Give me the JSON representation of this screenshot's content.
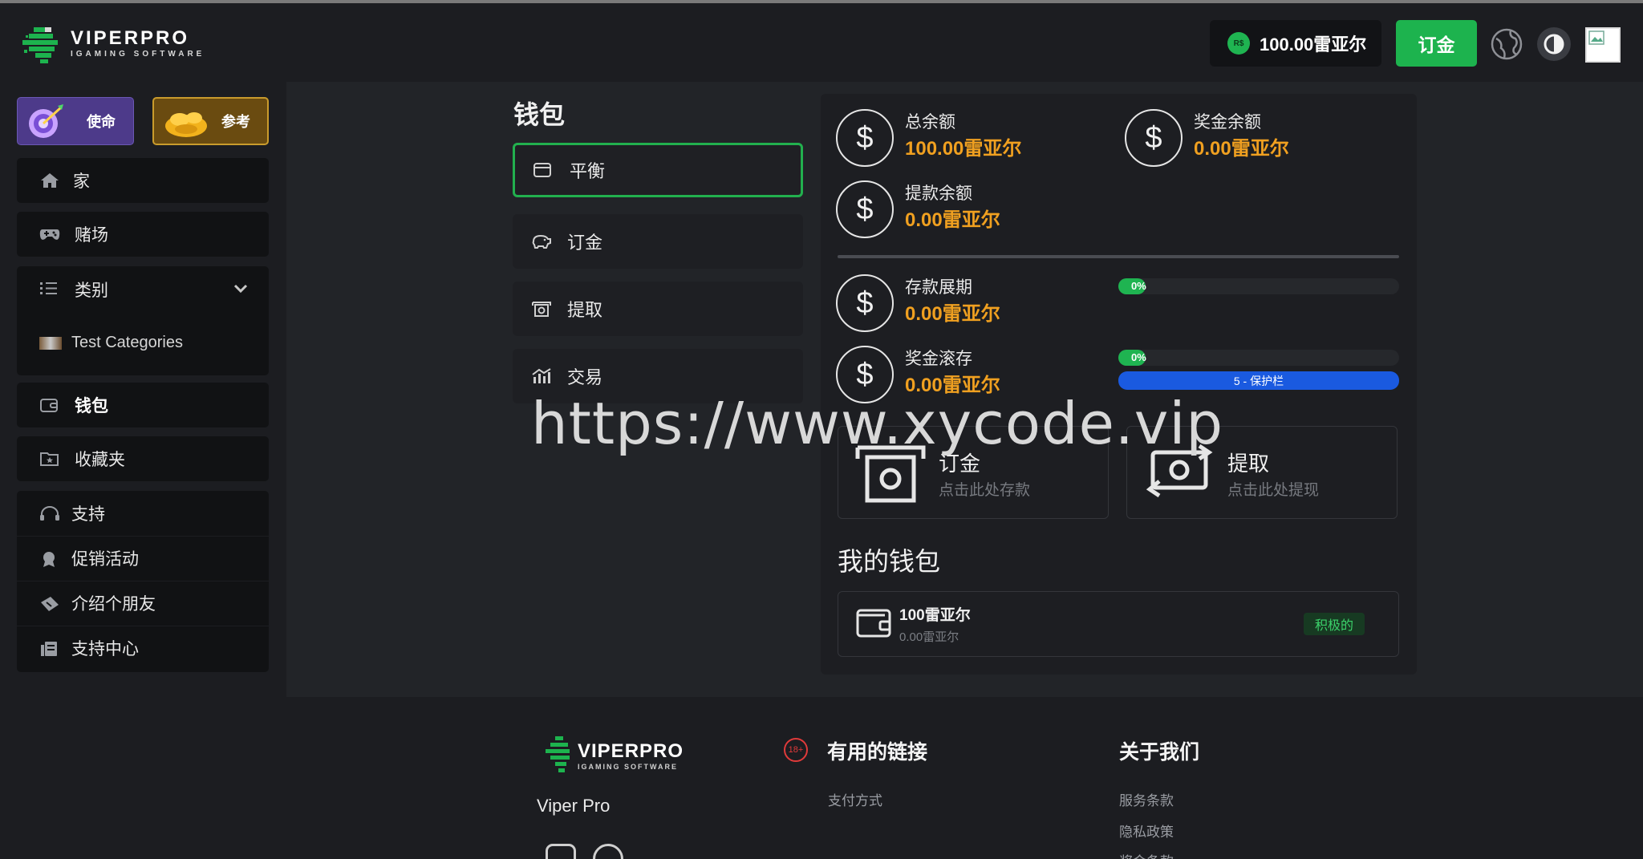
{
  "header": {
    "logo_name": "VIPERPRO",
    "logo_sub": "IGAMING SOFTWARE",
    "coin_symbol": "R$",
    "balance": "100.00雷亚尔",
    "deposit_label": "订金",
    "icons": [
      "globe-icon",
      "theme-toggle-icon",
      "avatar-image"
    ]
  },
  "sidebar": {
    "promo": [
      {
        "label": "使命",
        "icon": "target-icon"
      },
      {
        "label": "参考",
        "icon": "coins-icon"
      }
    ],
    "items": [
      {
        "label": "家",
        "icon": "home-icon"
      },
      {
        "label": "赌场",
        "icon": "gamepad-icon"
      },
      {
        "label": "类别",
        "icon": "list-icon"
      },
      {
        "label": "钱包",
        "icon": "wallet-icon"
      },
      {
        "label": "收藏夹",
        "icon": "folder-star-icon"
      }
    ],
    "category_sub": "Test Categories",
    "support": [
      {
        "label": "支持",
        "icon": "headset-icon"
      },
      {
        "label": "促销活动",
        "icon": "award-icon"
      },
      {
        "label": "介绍个朋友",
        "icon": "ticket-icon"
      },
      {
        "label": "支持中心",
        "icon": "book-icon"
      }
    ]
  },
  "wallet": {
    "title": "钱包",
    "tabs": [
      {
        "label": "平衡",
        "icon": "wallet-icon",
        "active": true
      },
      {
        "label": "订金",
        "icon": "piggy-bank-icon",
        "active": false
      },
      {
        "label": "提取",
        "icon": "cash-icon",
        "active": false
      },
      {
        "label": "交易",
        "icon": "chart-icon",
        "active": false
      }
    ]
  },
  "stats": {
    "total_label": "总余额",
    "total_value": "100.00雷亚尔",
    "bonus_label": "奖金余额",
    "bonus_value": "0.00雷亚尔",
    "withdraw_label": "提款余额",
    "withdraw_value": "0.00雷亚尔",
    "rollover_deposit_label": "存款展期",
    "rollover_deposit_value": "0.00雷亚尔",
    "rollover_deposit_progress": "0%",
    "rollover_bonus_label": "奖金滚存",
    "rollover_bonus_value": "0.00雷亚尔",
    "rollover_bonus_progress": "0%",
    "guard_bar": "5 - 保护栏",
    "dollar": "$"
  },
  "actions": {
    "deposit_title": "订金",
    "deposit_sub": "点击此处存款",
    "withdraw_title": "提取",
    "withdraw_sub": "点击此处提现"
  },
  "my_wallet": {
    "title": "我的钱包",
    "amount": "100雷亚尔",
    "sub": "0.00雷亚尔",
    "status": "积极的"
  },
  "footer": {
    "logo_name": "VIPERPRO",
    "logo_sub": "IGAMING SOFTWARE",
    "brand": "Viper Pro",
    "age_badge": "18+",
    "useful_links_title": "有用的链接",
    "useful_links": [
      "支付方式"
    ],
    "about_title": "关于我们",
    "about_links": [
      "服务条款",
      "隐私政策",
      "奖金条款"
    ]
  },
  "watermark": "https://www.xycode.vip",
  "colors": {
    "accent_green": "#1db34e",
    "value_orange": "#f0a020",
    "guard_blue": "#1a5ae0",
    "background": "#24262b"
  }
}
